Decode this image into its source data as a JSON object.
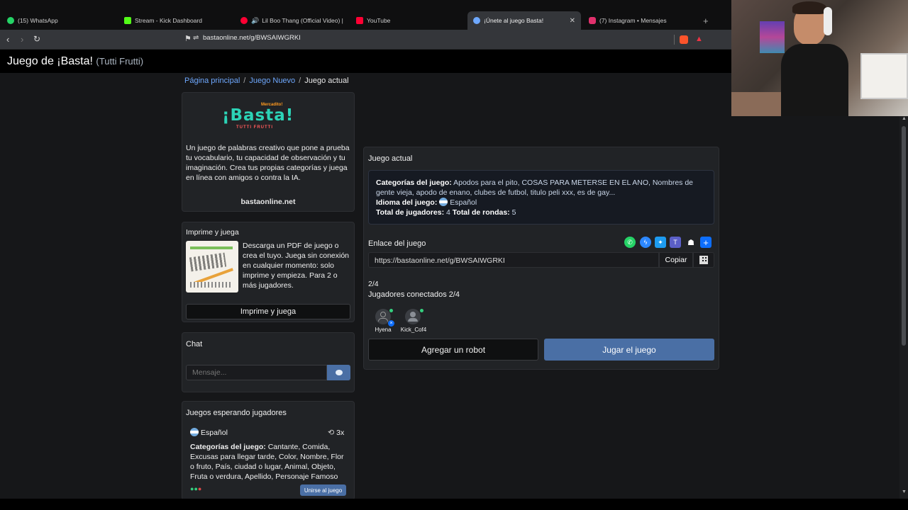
{
  "browser": {
    "tabs": [
      {
        "label": "(15) WhatsApp",
        "color": "#25d366"
      },
      {
        "label": "Stream - Kick Dashboard",
        "color": "#53fc18"
      },
      {
        "label": "Lil Boo Thang (Official Video) | Yo",
        "color": "#ff0033"
      },
      {
        "label": "YouTube",
        "color": "#ff0033"
      },
      {
        "label": "¡Únete al juego Basta!",
        "color": "#6ea8fe"
      },
      {
        "label": "(7) Instagram • Mensajes",
        "color": "#e1306c"
      }
    ],
    "url": "bastaonline.net/g/BWSAIWGRKI"
  },
  "site": {
    "title": "Juego de ¡Basta!",
    "subtitle": "(Tutti Frutti)"
  },
  "breadcrumb": {
    "home": "Página principal",
    "new_game": "Juego Nuevo",
    "current": "Juego actual",
    "sep": "/"
  },
  "about": {
    "logo_top": "Mercadito!",
    "logo_main": "¡Basta!",
    "logo_bottom": "TUTTI FRUTTI",
    "description": "Un juego de palabras creativo que pone a prueba tu vocabulario, tu capacidad de observación y tu imaginación. Crea tus propias categorías y juega en línea con amigos o contra la IA.",
    "domain": "bastaonline.net"
  },
  "print": {
    "title": "Imprime y juega",
    "description": "Descarga un PDF de juego o crea el tuyo. Juega sin conexión en cualquier momento: solo imprime y empieza. Para 2 o más jugadores.",
    "button": "Imprime y juega"
  },
  "chat": {
    "title": "Chat",
    "placeholder": "Mensaje..."
  },
  "waiting": {
    "title": "Juegos esperando jugadores",
    "language": "Español",
    "rounds": "3x",
    "categories_label": "Categorías del juego:",
    "categories": "Cantante, Comida, Excusas para llegar tarde, Color, Nombre, Flor o fruto, País, ciudad o lugar, Animal, Objeto, Fruta o verdura, Apellido, Personaje Famoso",
    "join_button": "Unirse al juego"
  },
  "game": {
    "title": "Juego actual",
    "categories_label": "Categorías del juego:",
    "categories": "Apodos para el pito, COSAS PARA METERSE EN EL ANO, Nombres de gente vieja, apodo de enano, clubes de futbol, titulo peli xxx, es de gay...",
    "language_label": "Idioma del juego:",
    "language": "Español",
    "players_label": "Total de jugadores:",
    "players": "4",
    "rounds_label": "Total de rondas:",
    "rounds": "5",
    "link_label": "Enlace del juego",
    "link": "https://bastaonline.net/g/BWSAIWGRKI",
    "copy_button": "Copiar",
    "count": "2/4",
    "connected": "Jugadores conectados 2/4",
    "players_list": [
      {
        "name": "Hyena"
      },
      {
        "name": "Kick_Cof4"
      }
    ],
    "add_robot": "Agregar un robot",
    "play": "Jugar el juego"
  },
  "colors": {
    "primary_button": "#4a6fa5",
    "link": "#6ea8fe",
    "accent_teal": "#2cd3b6"
  }
}
